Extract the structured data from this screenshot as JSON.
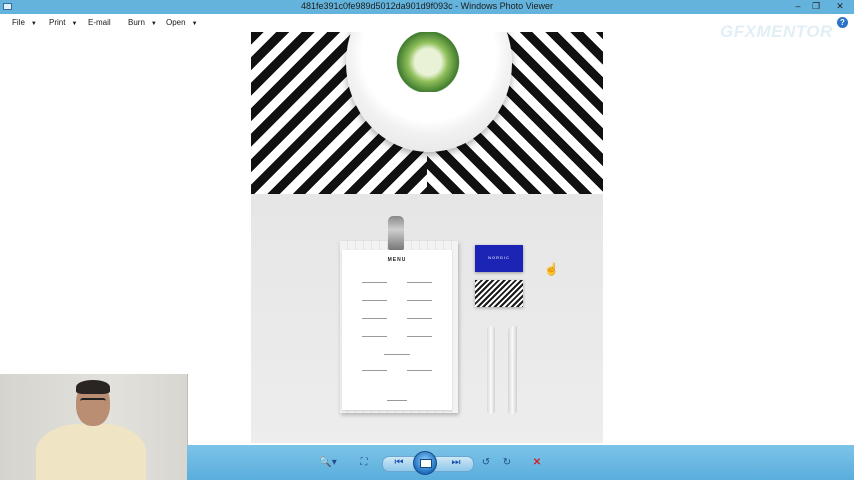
{
  "window": {
    "title": "481fe391c0fe989d5012da901d9f093c - Windows Photo Viewer",
    "minimize_glyph": "–",
    "maximize_glyph": "❐",
    "close_glyph": "✕"
  },
  "menubar": {
    "items": [
      {
        "label": "File",
        "arrow": "▼"
      },
      {
        "label": "Print",
        "arrow": "▼"
      },
      {
        "label": "E-mail",
        "arrow": ""
      },
      {
        "label": "Burn",
        "arrow": "▼"
      },
      {
        "label": "Open",
        "arrow": "▼"
      }
    ],
    "help_glyph": "?"
  },
  "watermark": "GFXMENTOR",
  "photo": {
    "menu_heading": "MENU",
    "card_logo": "NORDIC"
  },
  "toolbar": {
    "zoom_glyph": "🔍▾",
    "fit_glyph": "⛶",
    "prev_glyph": "⏮",
    "next_glyph": "⏭",
    "rotate_left_glyph": "↺",
    "rotate_right_glyph": "↻",
    "delete_glyph": "✕"
  },
  "colors": {
    "titlebar": "#63b3dc",
    "toolbar": "#5aaedc",
    "card_blue": "#1b24b5",
    "delete_red": "#d3232a"
  }
}
